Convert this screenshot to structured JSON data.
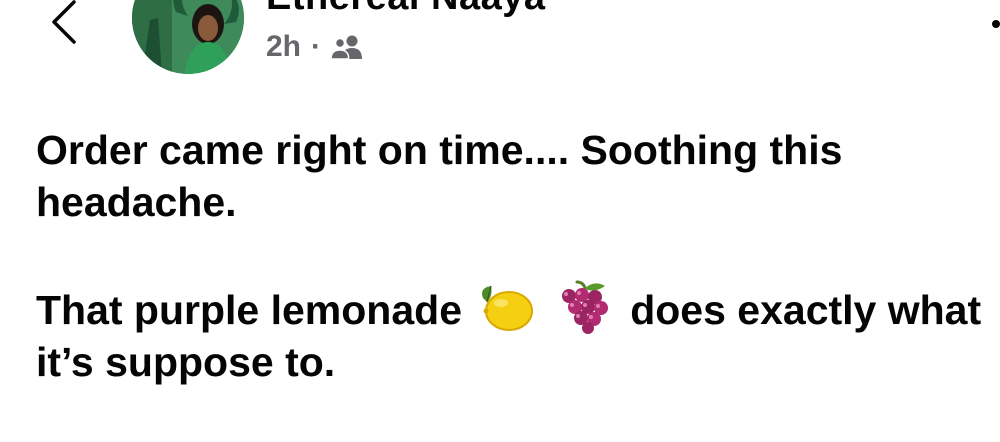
{
  "header": {
    "author_name": "Ethereal Naaya",
    "timestamp": "2h",
    "separator": "·",
    "audience_icon": "friends-icon",
    "back_icon": "chevron-left-icon",
    "more_icon": "more-options-icon"
  },
  "post": {
    "paragraph1": "Order came right on time.... Soothing this headache.",
    "paragraph2": {
      "before": "That purple lemonade",
      "emoji1": "lemon-emoji",
      "emoji2": "grapes-emoji",
      "after": "does exactly what it’s suppose to."
    }
  },
  "colors": {
    "text": "#050505",
    "meta": "#65676b",
    "avatar_green": "#3f8a5b"
  }
}
